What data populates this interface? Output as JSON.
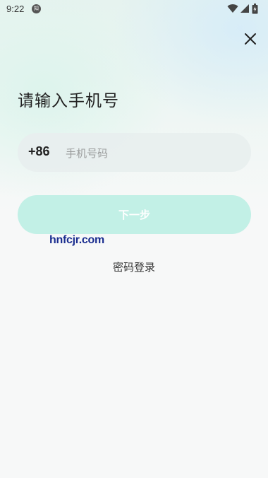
{
  "status_bar": {
    "time": "9:22",
    "notification_icon": "app-notification-icon",
    "notification_badge": "知",
    "icons": [
      "wifi-icon",
      "signal-icon",
      "battery-icon"
    ]
  },
  "header": {
    "close_icon": "close-icon"
  },
  "login": {
    "title": "请输入手机号",
    "country_code": "+86",
    "phone_placeholder": "手机号码",
    "phone_value": "",
    "next_label": "下一步",
    "password_login_label": "密码登录"
  },
  "watermark": "hnfcjr.com",
  "colors": {
    "accent_disabled": "#c2f0e6",
    "field_bg": "#e8eeee",
    "title_text": "#222222",
    "watermark": "#1a2d8f"
  }
}
